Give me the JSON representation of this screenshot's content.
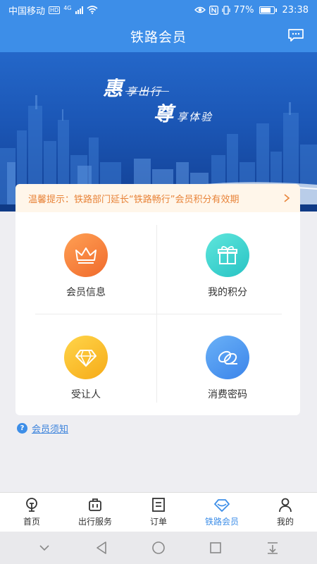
{
  "status_bar": {
    "carrier": "中国移动",
    "network_badge": "HD",
    "signal_label": "4G",
    "battery": "77%",
    "time": "23:38"
  },
  "header": {
    "title": "铁路会员",
    "message_icon": "chat-icon"
  },
  "banner": {
    "line1_big": "惠",
    "line1_rest": "享出行",
    "line2_big": "尊",
    "line2_rest": "享体验"
  },
  "notice": {
    "text": "温馨提示：铁路部门延长“铁路畅行”会员积分有效期"
  },
  "grid": {
    "items": [
      {
        "label": "会员信息",
        "icon": "crown-icon",
        "color": "#f47a35"
      },
      {
        "label": "我的积分",
        "icon": "gift-icon",
        "color": "#34ccc8"
      },
      {
        "label": "受让人",
        "icon": "diamond-icon",
        "color": "#f9bb26"
      },
      {
        "label": "消费密码",
        "icon": "coins-icon",
        "color": "#4a91ee"
      }
    ]
  },
  "rules_link": {
    "label": "会员须知"
  },
  "tabbar": {
    "tabs": [
      {
        "label": "首页",
        "icon": "home-icon",
        "active": false
      },
      {
        "label": "出行服务",
        "icon": "luggage-icon",
        "active": false
      },
      {
        "label": "订单",
        "icon": "order-icon",
        "active": false
      },
      {
        "label": "铁路会员",
        "icon": "diamond-icon",
        "active": true
      },
      {
        "label": "我的",
        "icon": "user-icon",
        "active": false
      }
    ]
  },
  "colors": {
    "brand": "#3d8ee8",
    "notice_bg": "#fff6ea",
    "notice_text": "#e8843a"
  }
}
